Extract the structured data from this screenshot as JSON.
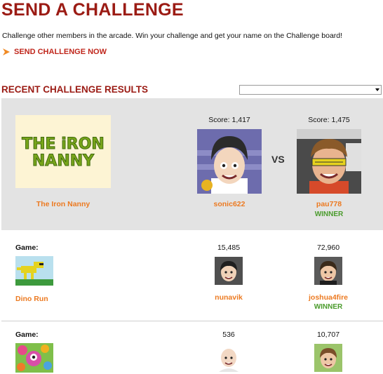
{
  "header": {
    "title": "SEND A CHALLENGE",
    "intro": "Challenge other members in the arcade. Win your challenge and get your name on the Challenge board!",
    "send_link": "SEND CHALLENGE NOW"
  },
  "results": {
    "heading": "RECENT CHALLENGE RESULTS",
    "filter_value": ""
  },
  "featured": {
    "game_logo_line1": "THE iRON",
    "game_logo_line2": "NANNY",
    "game_name": "The Iron Nanny",
    "vs": "VS",
    "player1": {
      "score_label": "Score: 1,417",
      "name": "sonic622"
    },
    "player2": {
      "score_label": "Score: 1,475",
      "name": "pau778",
      "status": "WINNER"
    }
  },
  "challenges": [
    {
      "game_label": "Game:",
      "game_name": "Dino Run",
      "player1": {
        "score": "15,485",
        "name": "nunavik"
      },
      "player2": {
        "score": "72,960",
        "name": "joshua4fire",
        "status": "WINNER"
      }
    },
    {
      "game_label": "Game:",
      "game_name": "",
      "player1": {
        "score": "536",
        "name": ""
      },
      "player2": {
        "score": "10,707",
        "name": ""
      }
    }
  ],
  "colors": {
    "brand_red": "#9b1b14",
    "link_orange": "#ec7a21",
    "winner_green": "#4a9b2c",
    "featured_bg": "#e3e3e3"
  },
  "icons": [
    "arrow-right-icon",
    "chevron-down-icon"
  ]
}
